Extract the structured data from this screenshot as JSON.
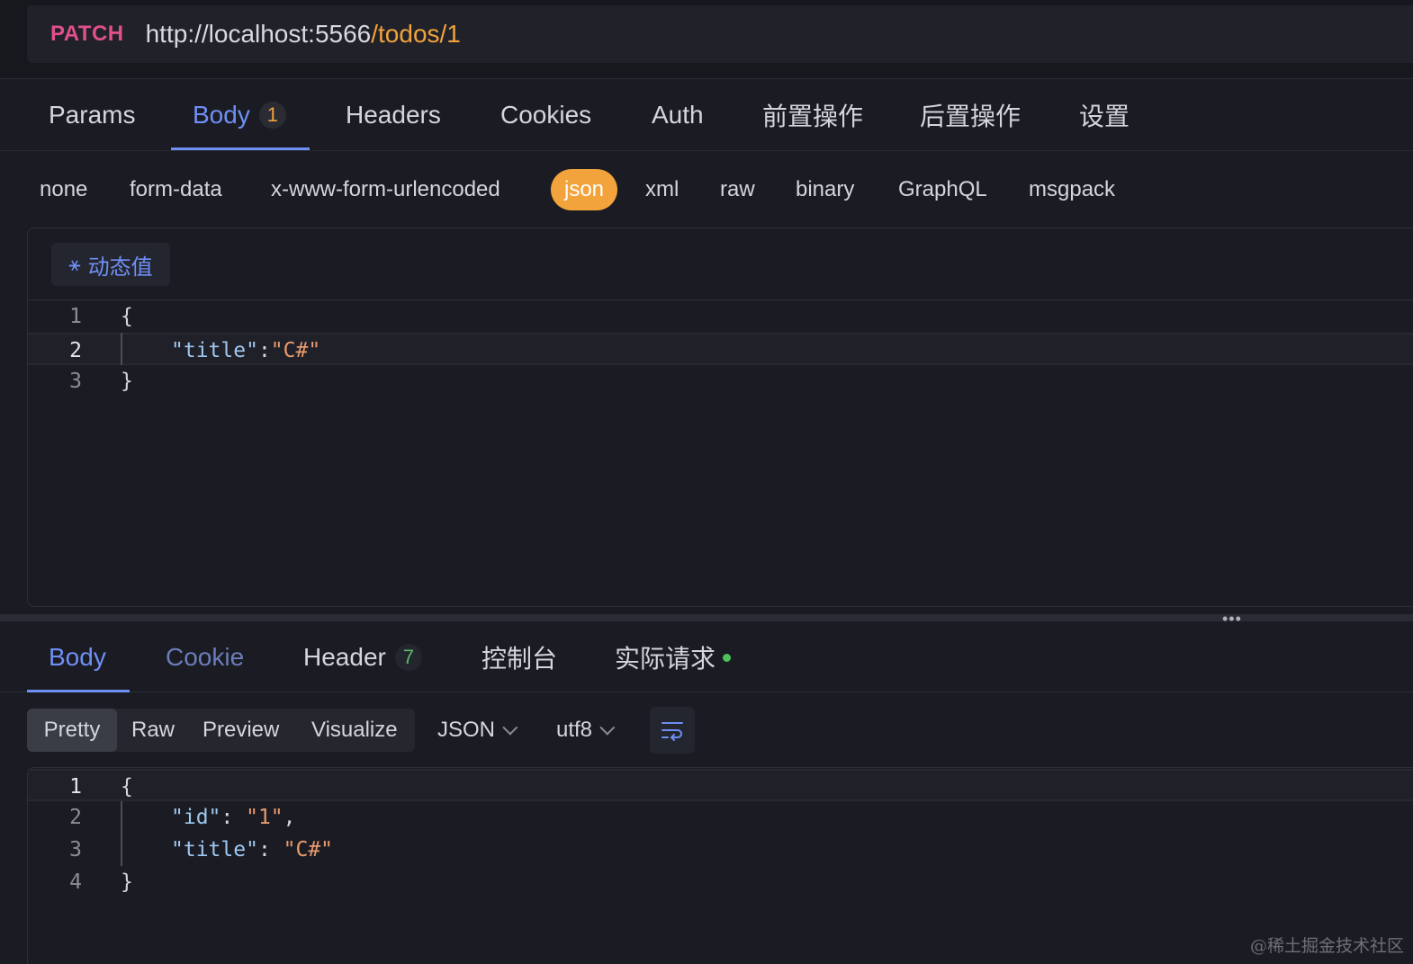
{
  "request": {
    "method": "PATCH",
    "url_base": "http://localhost:5566",
    "url_path": "/todos/1"
  },
  "request_tabs": [
    {
      "label": "Params"
    },
    {
      "label": "Body",
      "badge": "1"
    },
    {
      "label": "Headers"
    },
    {
      "label": "Cookies"
    },
    {
      "label": "Auth"
    },
    {
      "label": "前置操作"
    },
    {
      "label": "后置操作"
    },
    {
      "label": "设置"
    }
  ],
  "body_types": [
    "none",
    "form-data",
    "x-www-form-urlencoded",
    "json",
    "xml",
    "raw",
    "binary",
    "GraphQL",
    "msgpack"
  ],
  "body_type_selected": "json",
  "dynamic_value_label": "动态值",
  "request_body_lines": [
    {
      "num": "1",
      "open": "{"
    },
    {
      "num": "2",
      "key": "\"title\"",
      "sep": ":",
      "value": "\"C#\""
    },
    {
      "num": "3",
      "close": "}"
    }
  ],
  "response_tabs": [
    {
      "label": "Body"
    },
    {
      "label": "Cookie"
    },
    {
      "label": "Header",
      "badge": "7"
    },
    {
      "label": "控制台"
    },
    {
      "label": "实际请求"
    }
  ],
  "view_modes": [
    "Pretty",
    "Raw",
    "Preview",
    "Visualize"
  ],
  "view_mode_selected": "Pretty",
  "format": "JSON",
  "encoding": "utf8",
  "response_body_lines": [
    {
      "num": "1",
      "open": "{"
    },
    {
      "num": "2",
      "key": "\"id\"",
      "sep": ": ",
      "value": "\"1\"",
      "tail": ","
    },
    {
      "num": "3",
      "key": "\"title\"",
      "sep": ": ",
      "value": "\"C#\""
    },
    {
      "num": "4",
      "close": "}"
    }
  ],
  "watermark": "@稀土掘金技术社区",
  "colors": {
    "accent": "#6f8ff5",
    "method": "#e0508a",
    "selected_pill": "#f2a33b",
    "status_dot": "#4ec15a"
  }
}
